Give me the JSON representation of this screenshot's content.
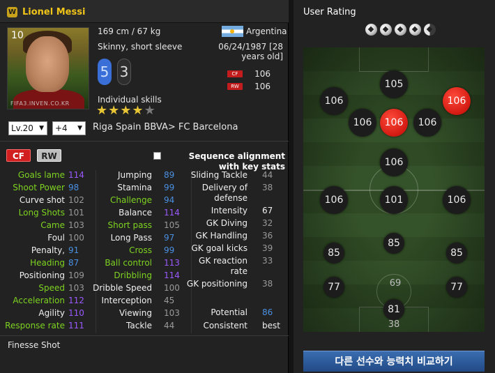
{
  "player": {
    "badge": "W",
    "name": "Lionel Messi",
    "number": "10",
    "watermark": "FIFA3.INVEN.CO.KR",
    "height_weight": "169 cm / 67 kg",
    "body_type": "Skinny, short sleeve",
    "country": "Argentina",
    "birth": "06/24/1987 [28 years old]",
    "left_foot": "5",
    "right_foot": "3",
    "positions": [
      {
        "label": "CF",
        "value": "106"
      },
      {
        "label": "RW",
        "value": "106"
      }
    ],
    "skills_label": "Individual skills",
    "skill_stars": 4,
    "skill_stars_max": 5,
    "level_select": "Lv.20",
    "plus_select": "+4",
    "club": "Riga Spain BBVA> FC Barcelona"
  },
  "tabs": {
    "cf": "CF",
    "rw": "RW"
  },
  "sequence_label": "Sequence alignment with key stats",
  "stats": {
    "col1": [
      {
        "name": "Goals lame",
        "value": "114",
        "nc": "g",
        "vc": "p"
      },
      {
        "name": "Shoot Power",
        "value": "98",
        "nc": "g",
        "vc": "b"
      },
      {
        "name": "Curve shot",
        "value": "102",
        "nc": "w",
        "vc": "gr"
      },
      {
        "name": "Long Shots",
        "value": "101",
        "nc": "g",
        "vc": "gr"
      },
      {
        "name": "Came",
        "value": "103",
        "nc": "g",
        "vc": "gr"
      },
      {
        "name": "Foul",
        "value": "100",
        "nc": "w",
        "vc": "gr"
      },
      {
        "name": "Penalty,",
        "value": "91",
        "nc": "w",
        "vc": "b"
      },
      {
        "name": "Heading",
        "value": "87",
        "nc": "g",
        "vc": "b"
      },
      {
        "name": "Positioning",
        "value": "109",
        "nc": "w",
        "vc": "gr"
      },
      {
        "name": "Speed",
        "value": "103",
        "nc": "g",
        "vc": "gr"
      },
      {
        "name": "Acceleration",
        "value": "112",
        "nc": "g",
        "vc": "p"
      },
      {
        "name": "Agility",
        "value": "110",
        "nc": "w",
        "vc": "p"
      },
      {
        "name": "Response rate",
        "value": "111",
        "nc": "g",
        "vc": "p"
      }
    ],
    "col2": [
      {
        "name": "Jumping",
        "value": "89",
        "nc": "w",
        "vc": "b"
      },
      {
        "name": "Stamina",
        "value": "99",
        "nc": "w",
        "vc": "b"
      },
      {
        "name": "Challenge",
        "value": "94",
        "nc": "g",
        "vc": "b"
      },
      {
        "name": "Balance",
        "value": "114",
        "nc": "w",
        "vc": "p"
      },
      {
        "name": "Short pass",
        "value": "105",
        "nc": "g",
        "vc": "gr"
      },
      {
        "name": "Long Pass",
        "value": "97",
        "nc": "w",
        "vc": "b"
      },
      {
        "name": "Cross",
        "value": "99",
        "nc": "g",
        "vc": "b"
      },
      {
        "name": "Ball control",
        "value": "113",
        "nc": "g",
        "vc": "p"
      },
      {
        "name": "Dribbling",
        "value": "114",
        "nc": "g",
        "vc": "p"
      },
      {
        "name": "Dribble Speed",
        "value": "100",
        "nc": "w",
        "vc": "gr"
      },
      {
        "name": "Interception",
        "value": "45",
        "nc": "w",
        "vc": "gr"
      },
      {
        "name": "Viewing",
        "value": "103",
        "nc": "w",
        "vc": "gr"
      },
      {
        "name": "Tackle",
        "value": "44",
        "nc": "w",
        "vc": "gr"
      }
    ],
    "col3": [
      {
        "name": "Sliding Tackle",
        "value": "44",
        "nc": "w",
        "vc": "gr"
      },
      {
        "name": "Delivery of defense",
        "value": "38",
        "nc": "w",
        "vc": "gr"
      },
      {
        "name": "Intensity",
        "value": "67",
        "nc": "w",
        "vc": "w"
      },
      {
        "name": "GK Diving",
        "value": "32",
        "nc": "w",
        "vc": "gr"
      },
      {
        "name": "GK Handling",
        "value": "36",
        "nc": "w",
        "vc": "gr"
      },
      {
        "name": "GK goal kicks",
        "value": "39",
        "nc": "w",
        "vc": "gr"
      },
      {
        "name": "GK reaction rate",
        "value": "33",
        "nc": "w",
        "vc": "gr"
      },
      {
        "name": "GK positioning",
        "value": "38",
        "nc": "w",
        "vc": "gr"
      },
      {
        "name": "Potential",
        "value": "86",
        "nc": "w",
        "vc": "b"
      },
      {
        "name": "Consistent",
        "value": "best",
        "nc": "w",
        "vc": "w"
      }
    ]
  },
  "trait": "Finesse Shot",
  "rating_panel": {
    "title": "User Rating",
    "rating_stars": 4.5,
    "rating_max": 5,
    "positions": [
      {
        "label": "105"
      },
      {
        "label": "106"
      },
      {
        "label": "106"
      },
      {
        "label": "106"
      },
      {
        "label": "106"
      },
      {
        "label": "106"
      },
      {
        "label": "106"
      },
      {
        "label": "106"
      },
      {
        "label": "101"
      },
      {
        "label": "106"
      },
      {
        "label": "85"
      },
      {
        "label": "85"
      },
      {
        "label": "85"
      },
      {
        "label": "77"
      },
      {
        "label": "69"
      },
      {
        "label": "77"
      },
      {
        "label": "81"
      },
      {
        "label": "38"
      }
    ],
    "highlight_color": "#d31a12",
    "compare_button": "다른 선수와 능력치 비교하기"
  }
}
